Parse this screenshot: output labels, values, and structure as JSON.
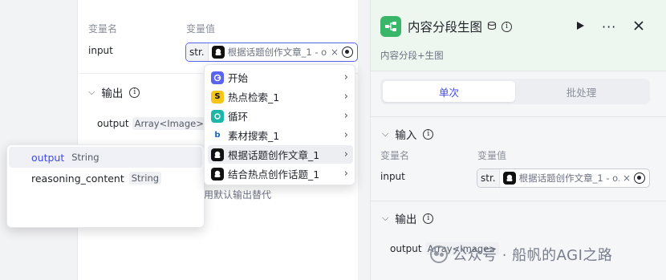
{
  "left_node": {
    "var_name_header": "变量名",
    "var_value_header": "变量值",
    "input_label": "input",
    "ref_type": "str.",
    "ref_value": "根据话题创作文章_1 - o.",
    "ref_clear": "×",
    "output_section": "输出",
    "output_row_label": "output",
    "output_row_type": "Array<Image>",
    "default_output_text": "用默认输出替代"
  },
  "output_popup": {
    "items": [
      {
        "name": "output",
        "type": "String"
      },
      {
        "name": "reasoning_content",
        "type": "String"
      }
    ]
  },
  "node_menu": {
    "items": [
      {
        "label": "开始",
        "icon": "start-node-icon",
        "color": "#5a64f0"
      },
      {
        "label": "热点检索_1",
        "icon": "hot-search-plugin-icon",
        "color": "#f5c518"
      },
      {
        "label": "循环",
        "icon": "loop-node-icon",
        "color": "#1db5a8"
      },
      {
        "label": "素材搜索_1",
        "icon": "material-search-icon",
        "color": "#ffffff"
      },
      {
        "label": "根据话题创作文章_1",
        "icon": "llm-node-icon",
        "color": "#111111"
      },
      {
        "label": "结合热点创作话题_1",
        "icon": "llm-node-icon",
        "color": "#111111"
      }
    ]
  },
  "right_panel": {
    "title": "内容分段生图",
    "subtitle": "内容分段+生图",
    "accent_color": "#3ab66b",
    "tabs": [
      {
        "label": "单次",
        "active": true
      },
      {
        "label": "批处理",
        "active": false
      }
    ],
    "input_section": "输入",
    "var_name_header": "变量名",
    "var_value_header": "变量值",
    "input_label": "input",
    "ref_type": "str.",
    "ref_value": "根据话题创作文章_1 - o.",
    "ref_clear": "×",
    "output_section": "输出",
    "output_row_label": "output",
    "output_row_type": "Array<Image>"
  },
  "watermark": "公众号 · 船帆的AGI之路"
}
